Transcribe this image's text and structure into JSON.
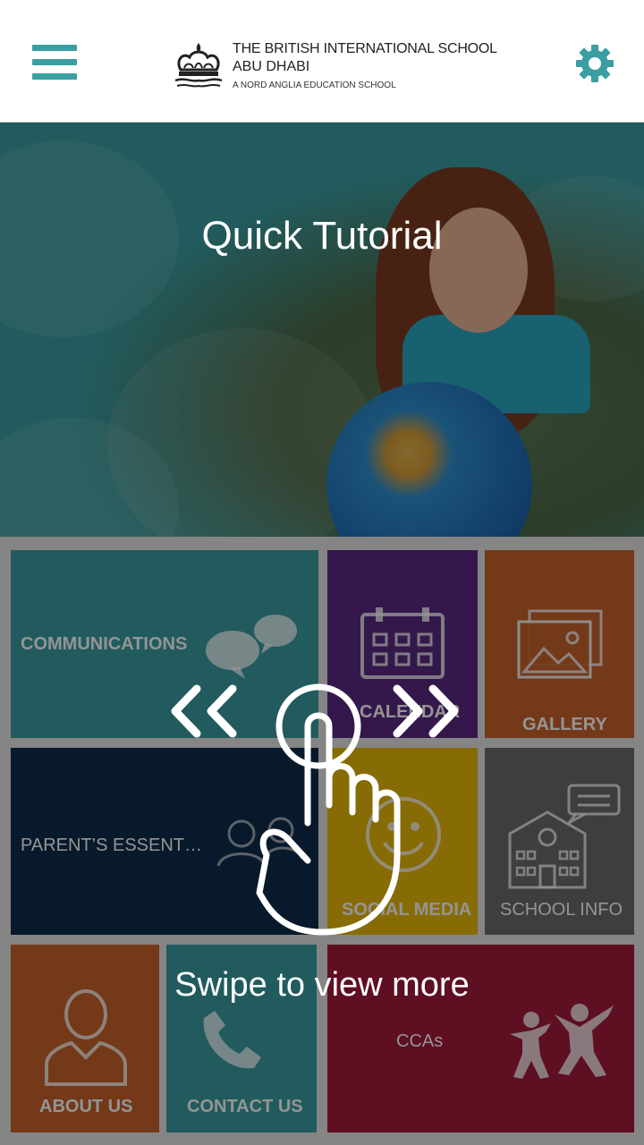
{
  "header": {
    "school_line1": "THE BRITISH INTERNATIONAL SCHOOL",
    "school_line2": "ABU DHABI",
    "school_line3": "A NORD ANGLIA EDUCATION SCHOOL"
  },
  "hero": {
    "title": "Quick Tutorial"
  },
  "tiles": {
    "communications": "COMMUNICATIONS",
    "calendar": "CALENDAR",
    "gallery": "GALLERY",
    "parents_essentials": "PARENT’S ESSENT…",
    "social_media": "SOCIAL MEDIA",
    "school_info": "SCHOOL INFO",
    "about_us": "ABOUT US",
    "contact_us": "CONTACT US",
    "ccas": "CCAs"
  },
  "tutorial": {
    "hint": "Swipe to view more"
  },
  "colors": {
    "teal": "#3a9ea3",
    "purple": "#5b2a84",
    "orange": "#c7622b",
    "navy": "#0f2c4a",
    "yellow": "#e9bb0c",
    "gray": "#6b6b6b",
    "crimson": "#a31a3b"
  },
  "icons": [
    "menu-icon",
    "gear-icon",
    "chat-bubbles-icon",
    "calendar-icon",
    "image-icon",
    "people-icon",
    "smiley-icon",
    "school-building-icon",
    "person-icon",
    "phone-icon",
    "children-icon",
    "swipe-left-icon",
    "swipe-right-icon",
    "hand-pointer-icon"
  ]
}
